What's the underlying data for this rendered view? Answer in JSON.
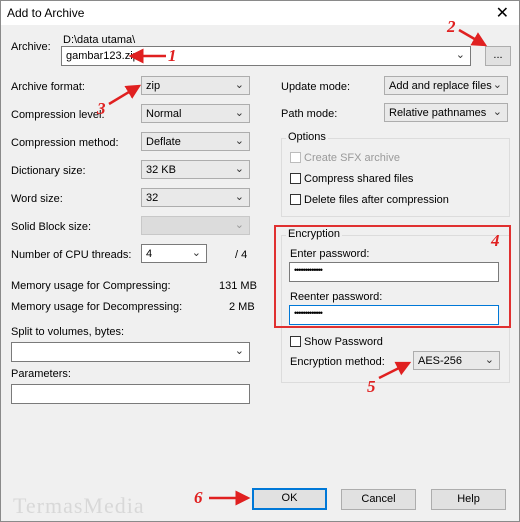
{
  "window": {
    "title": "Add to Archive",
    "close_glyph": "✕"
  },
  "archive": {
    "label": "Archive:",
    "path": "D:\\data utama\\",
    "filename": "gambar123.zip",
    "browse_label": "..."
  },
  "left": {
    "archive_format": {
      "label": "Archive format:",
      "value": "zip"
    },
    "compression_level": {
      "label": "Compression level:",
      "value": "Normal"
    },
    "compression_method": {
      "label": "Compression method:",
      "value": "Deflate"
    },
    "dictionary_size": {
      "label": "Dictionary size:",
      "value": "32 KB"
    },
    "word_size": {
      "label": "Word size:",
      "value": "32"
    },
    "solid_block_size": {
      "label": "Solid Block size:",
      "value": ""
    },
    "cpu_threads": {
      "label": "Number of CPU threads:",
      "value": "4",
      "max": "/ 4"
    },
    "memory_compress": {
      "label": "Memory usage for Compressing:",
      "value": "131 MB"
    },
    "memory_decompress": {
      "label": "Memory usage for Decompressing:",
      "value": "2 MB"
    },
    "split_volumes": {
      "label": "Split to volumes, bytes:",
      "value": ""
    },
    "parameters": {
      "label": "Parameters:",
      "value": ""
    }
  },
  "right": {
    "update_mode": {
      "label": "Update mode:",
      "value": "Add and replace files"
    },
    "path_mode": {
      "label": "Path mode:",
      "value": "Relative pathnames"
    },
    "options": {
      "title": "Options",
      "create_sfx": "Create SFX archive",
      "compress_shared": "Compress shared files",
      "delete_after": "Delete files after compression"
    },
    "encryption": {
      "title": "Encryption",
      "enter_password_label": "Enter password:",
      "enter_password_value": "•••••••••••••",
      "reenter_password_label": "Reenter password:",
      "reenter_password_value": "•••••••••••••",
      "show_password": "Show Password",
      "method_label": "Encryption method:",
      "method_value": "AES-256"
    }
  },
  "buttons": {
    "ok": "OK",
    "cancel": "Cancel",
    "help": "Help"
  },
  "annotations": [
    "1",
    "2",
    "3",
    "4",
    "5",
    "6"
  ],
  "watermark": "TermasMedia",
  "colors": {
    "annotation": "#e02020",
    "focus": "#0078d7"
  }
}
